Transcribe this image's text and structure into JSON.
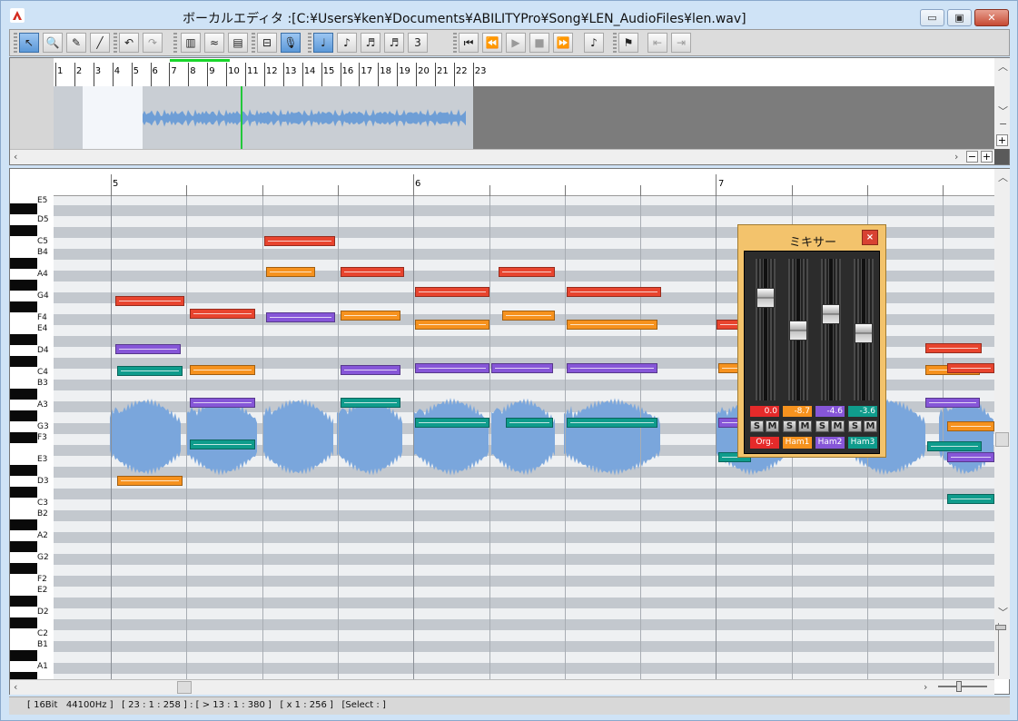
{
  "window": {
    "title": "ボーカルエディタ  :[C:¥Users¥ken¥Documents¥ABILITYPro¥Song¥LEN_AudioFiles¥len.wav]",
    "minimize": "▭",
    "restore": "▣",
    "close": "✕"
  },
  "toolbar": {
    "buttons": [
      {
        "name": "select-tool",
        "glyph": "↖",
        "active": true
      },
      {
        "name": "zoom-tool",
        "glyph": "🔍"
      },
      {
        "name": "pencil-tool",
        "glyph": "✎"
      },
      {
        "name": "line-tool",
        "glyph": "╱"
      },
      {
        "name": "undo",
        "glyph": "↶"
      },
      {
        "name": "redo",
        "glyph": "↷",
        "disabled": true
      },
      {
        "name": "view-1",
        "glyph": "▥"
      },
      {
        "name": "view-2",
        "glyph": "≈"
      },
      {
        "name": "view-3",
        "glyph": "▤"
      },
      {
        "name": "tool-a",
        "glyph": "⊟"
      },
      {
        "name": "mic-tool",
        "glyph": "🎙",
        "active": true
      },
      {
        "name": "note-quarter",
        "glyph": "♩",
        "active": true
      },
      {
        "name": "note-eighth",
        "glyph": "♪"
      },
      {
        "name": "note-16th",
        "glyph": "♬"
      },
      {
        "name": "note-32nd",
        "glyph": "♬"
      },
      {
        "name": "triplet",
        "glyph": "3"
      },
      {
        "name": "to-start",
        "glyph": "⏮"
      },
      {
        "name": "rewind",
        "glyph": "⏪"
      },
      {
        "name": "play",
        "glyph": "▶",
        "disabled": true
      },
      {
        "name": "stop",
        "glyph": "■",
        "disabled": true
      },
      {
        "name": "fast-forward",
        "glyph": "⏩"
      },
      {
        "name": "metronome",
        "glyph": "♪"
      },
      {
        "name": "marker",
        "glyph": "⚑"
      },
      {
        "name": "marker-prev",
        "glyph": "⇤",
        "disabled": true
      },
      {
        "name": "marker-next",
        "glyph": "⇥",
        "disabled": true
      }
    ]
  },
  "overview": {
    "measures": [
      "1",
      "2",
      "3",
      "4",
      "5",
      "6",
      "7",
      "8",
      "9",
      "10",
      "11",
      "12",
      "13",
      "14",
      "15",
      "16",
      "17",
      "18",
      "19",
      "20",
      "21",
      "22",
      "23"
    ]
  },
  "editor": {
    "measures": [
      "5",
      "6",
      "7"
    ],
    "keys": [
      "E5",
      "D5",
      "C5",
      "B4",
      "A4",
      "G4",
      "F4",
      "E4",
      "D4",
      "C4",
      "B3",
      "A3",
      "G3",
      "F3",
      "E3",
      "D3",
      "C3",
      "B2",
      "A2",
      "G2",
      "F2",
      "E2",
      "D2",
      "C2",
      "B1",
      "A1"
    ]
  },
  "mixer": {
    "title": "ミキサー",
    "close": "×",
    "channels": [
      {
        "label": "Org.",
        "value": "0.0",
        "color": "#e52a2a",
        "level": 0.76
      },
      {
        "label": "Ham1",
        "value": "-8.7",
        "color": "#f6921e",
        "level": 0.49
      },
      {
        "label": "Ham2",
        "value": "-4.6",
        "color": "#8656d8",
        "level": 0.63
      },
      {
        "label": "Ham3",
        "value": "-3.6",
        "color": "#0f9c8c",
        "level": 0.47
      }
    ],
    "solo": "S",
    "mute": "M"
  },
  "status": {
    "text": "[ 16Bit   44100Hz ]   [ 23 : 1 : 258 ] : [ > 13 : 1 : 380 ]   [ x 1 : 256 ]   [Select : ]"
  }
}
